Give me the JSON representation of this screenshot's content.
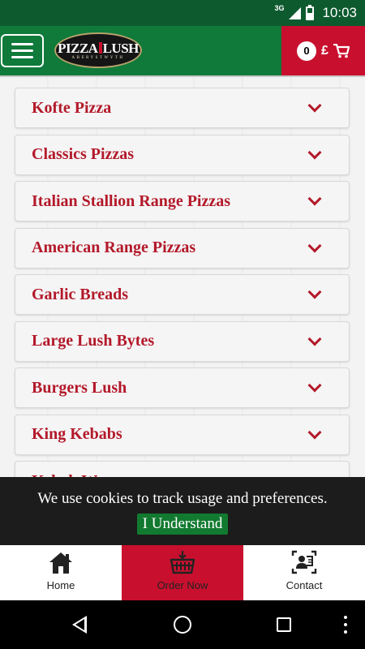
{
  "status_bar": {
    "network": "3G",
    "time": "10:03"
  },
  "header": {
    "logo_text_left": "PIZZA",
    "logo_text_right": "LUSH",
    "logo_subtitle": "ABERYSTWYTH",
    "cart_count": "0",
    "cart_currency": "£",
    "icons": {
      "menu": "hamburger-icon",
      "cart": "shopping-cart-icon"
    }
  },
  "categories": [
    {
      "label": "Kofte Pizza"
    },
    {
      "label": "Classics Pizzas"
    },
    {
      "label": "Italian Stallion Range Pizzas"
    },
    {
      "label": "American Range Pizzas"
    },
    {
      "label": "Garlic Breads"
    },
    {
      "label": "Large Lush Bytes"
    },
    {
      "label": "Burgers Lush"
    },
    {
      "label": "King Kebabs"
    },
    {
      "label": "Kebab Wraps"
    }
  ],
  "cookie_banner": {
    "message": "We use cookies to track usage and preferences.",
    "button_label": "I Understand"
  },
  "bottom_nav": {
    "items": [
      {
        "label": "Home",
        "icon": "home-icon",
        "active": false
      },
      {
        "label": "Order Now",
        "icon": "basket-icon",
        "active": true
      },
      {
        "label": "Contact",
        "icon": "contact-card-icon",
        "active": false
      }
    ]
  },
  "colors": {
    "header_green": "#0f7a3a",
    "status_green": "#0e5a2f",
    "accent_red": "#c8102e",
    "category_text": "#b3192a",
    "cookie_button": "#127a30"
  }
}
